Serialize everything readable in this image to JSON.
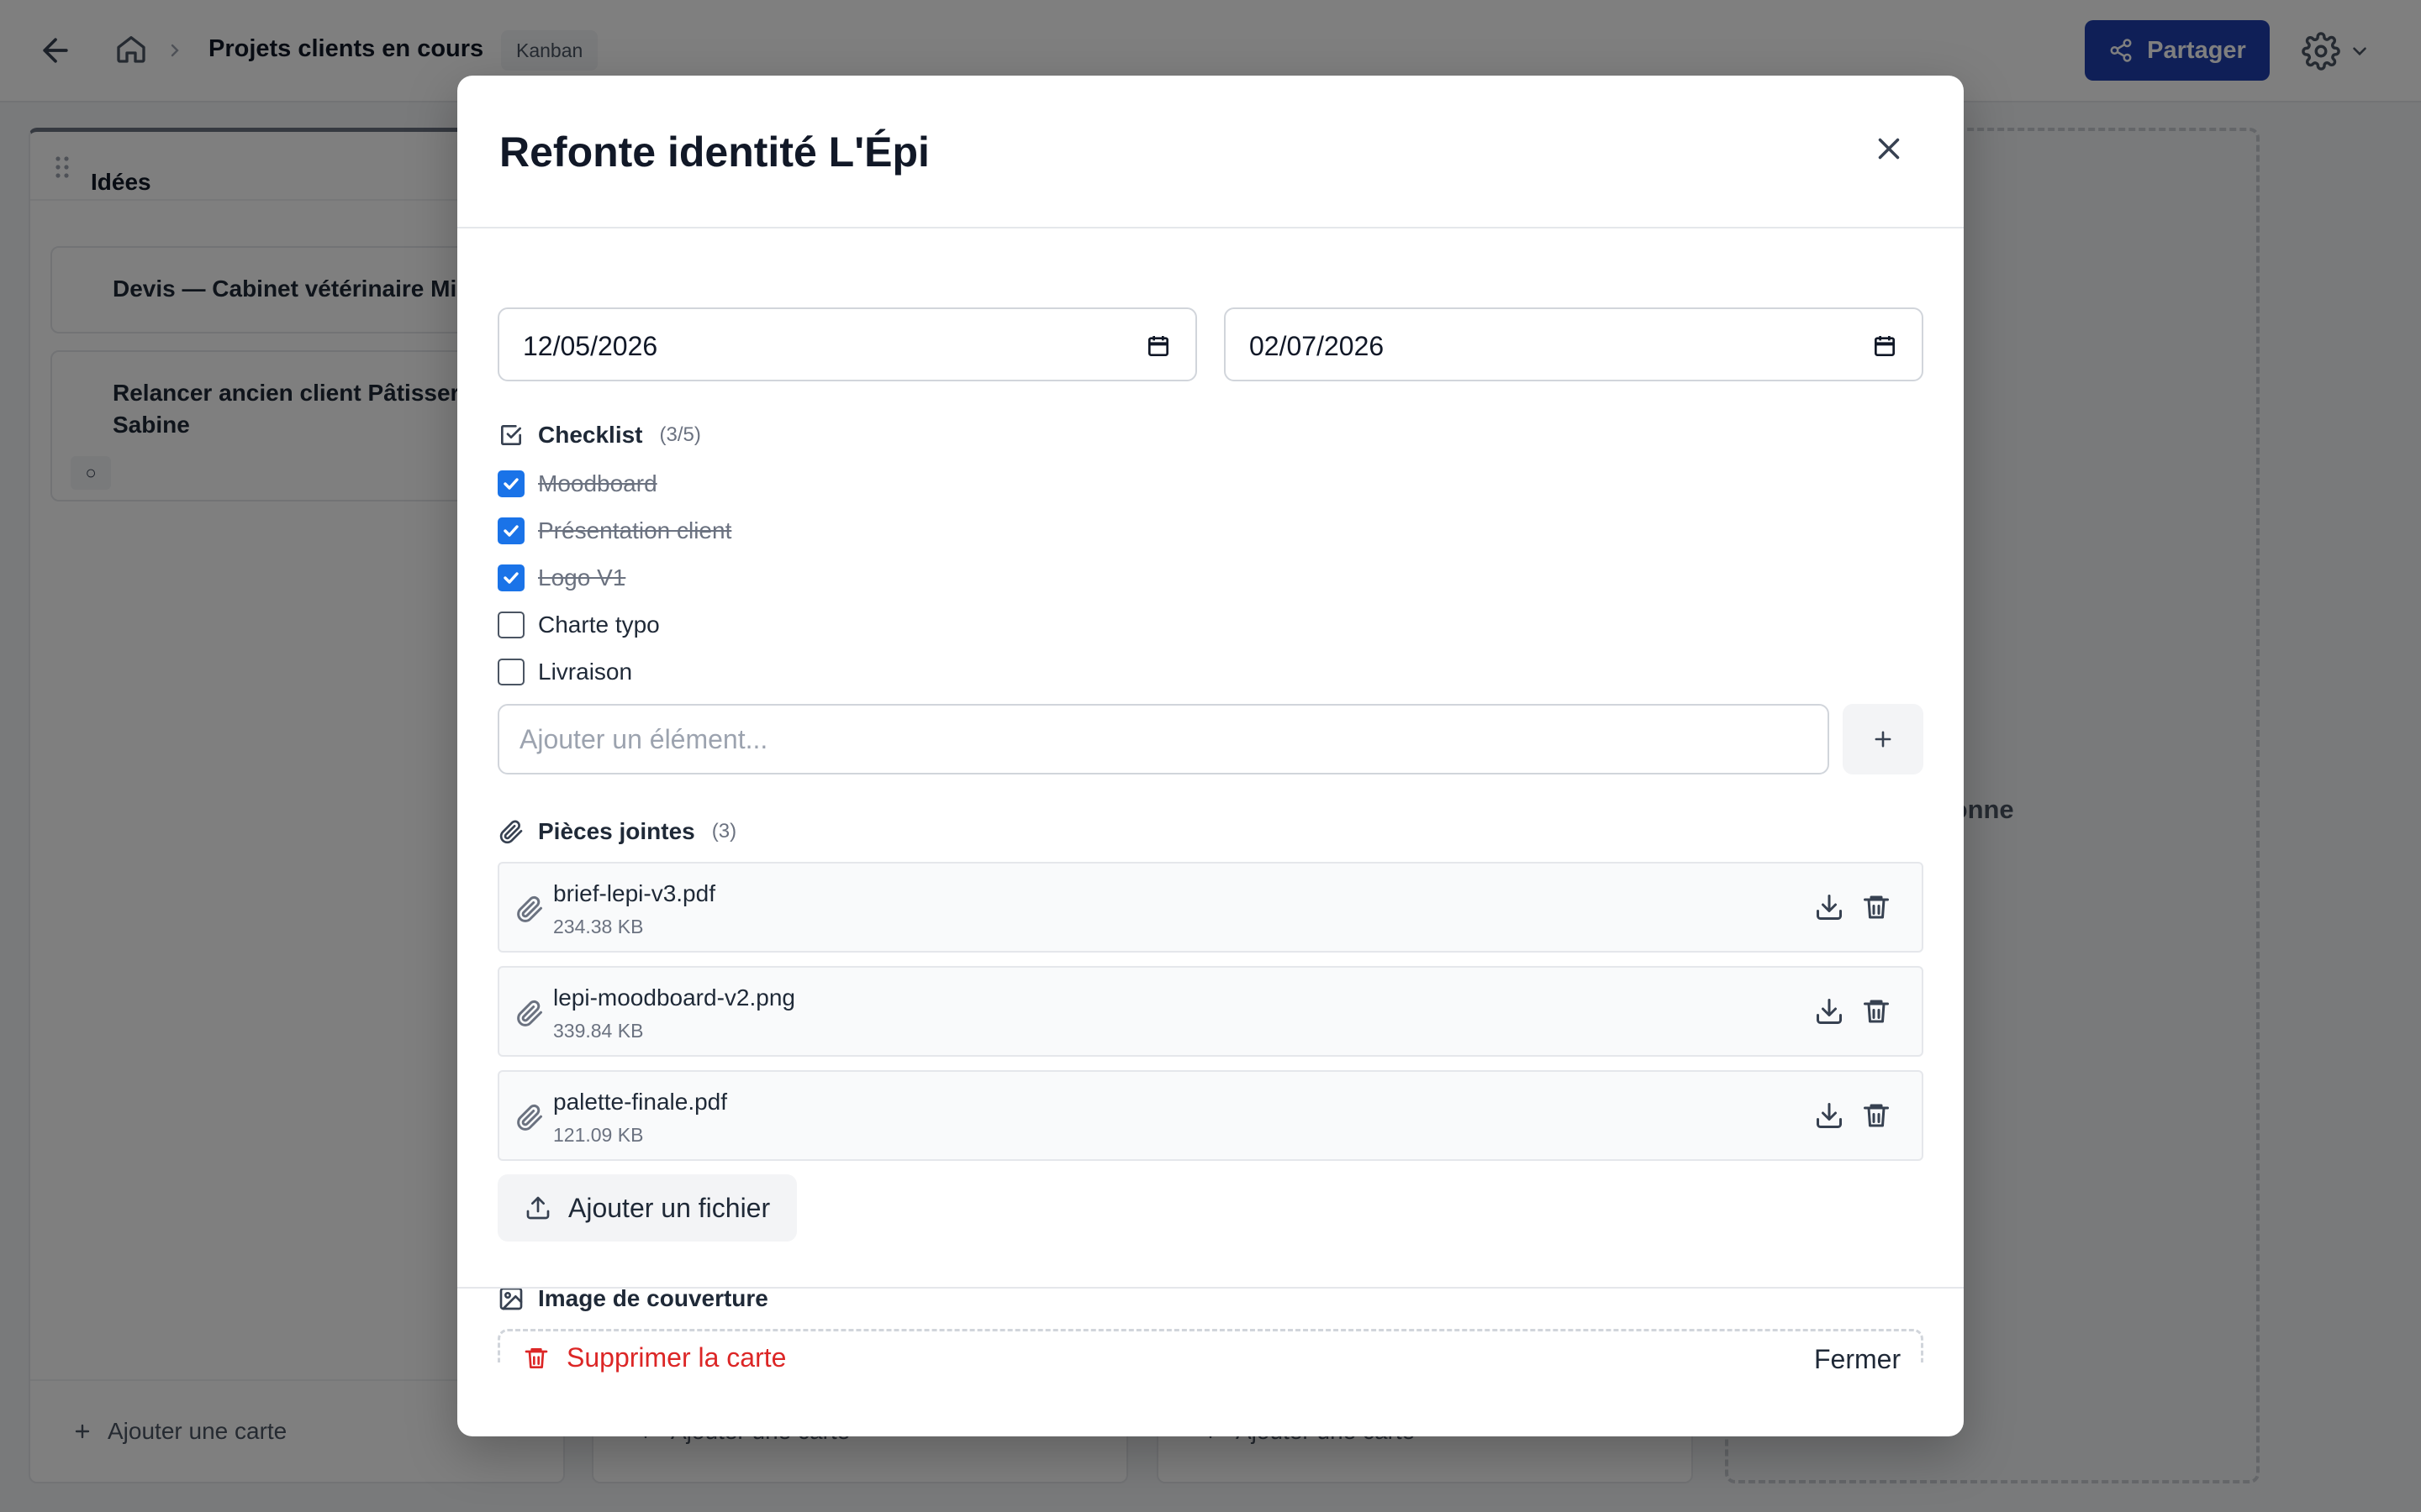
{
  "topbar": {
    "title": "Projets clients en cours",
    "view_badge": "Kanban",
    "share_label": "Partager"
  },
  "board": {
    "columns": [
      {
        "title": "Idées",
        "cards": [
          {
            "title": "Devis — Cabinet vétérinaire Mistral"
          },
          {
            "title": "Relancer ancien client Pâtisserie Sabine",
            "badge": "○"
          }
        ],
        "add_card_label": "Ajouter une carte"
      },
      {
        "add_card_label": "Ajouter une carte"
      },
      {
        "add_card_label": "Ajouter une carte"
      }
    ],
    "add_column_label": "Ajouter une colonne"
  },
  "modal": {
    "title": "Refonte identité L'Épi",
    "start_date": "12/05/2026",
    "due_date": "02/07/2026",
    "checklist": {
      "label": "Checklist",
      "count": "(3/5)",
      "items": [
        {
          "label": "Moodboard",
          "done": true
        },
        {
          "label": "Présentation client",
          "done": true
        },
        {
          "label": "Logo V1",
          "done": true
        },
        {
          "label": "Charte typo",
          "done": false
        },
        {
          "label": "Livraison",
          "done": false
        }
      ],
      "add_placeholder": "Ajouter un élément..."
    },
    "attachments": {
      "label": "Pièces jointes",
      "count": "(3)",
      "files": [
        {
          "name": "brief-lepi-v3.pdf",
          "size": "234.38 KB"
        },
        {
          "name": "lepi-moodboard-v2.png",
          "size": "339.84 KB"
        },
        {
          "name": "palette-finale.pdf",
          "size": "121.09 KB"
        }
      ],
      "add_label": "Ajouter un fichier"
    },
    "cover": {
      "label": "Image de couverture"
    },
    "footer": {
      "delete_label": "Supprimer la carte",
      "close_label": "Fermer"
    }
  },
  "colors": {
    "primary": "#1e3fae",
    "checkbox": "#1a73e8",
    "danger": "#dc2626",
    "overlay": "rgba(0,0,0,0.5)"
  }
}
